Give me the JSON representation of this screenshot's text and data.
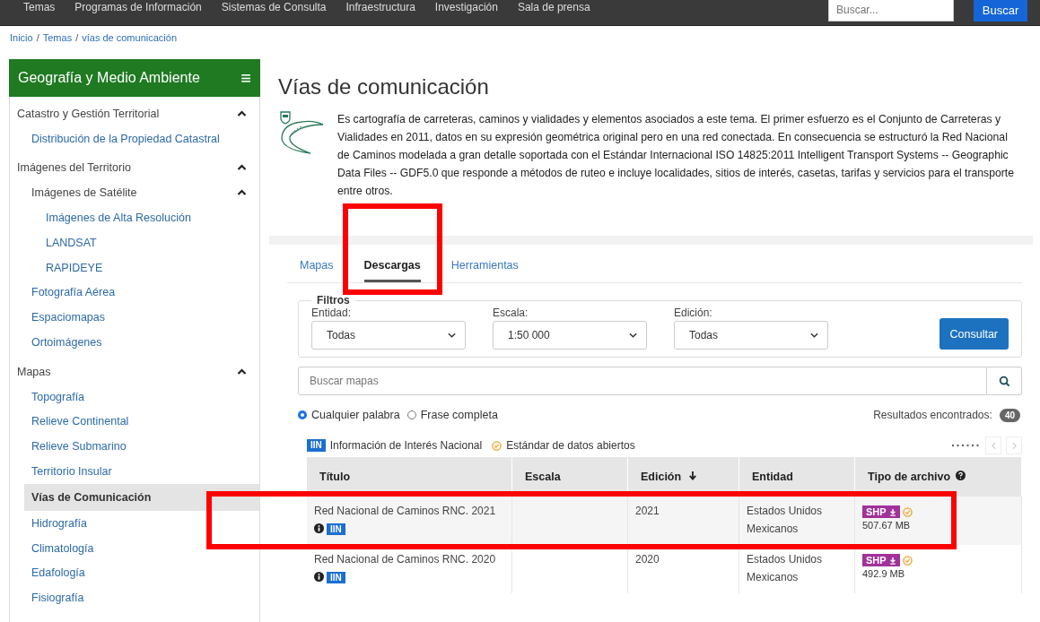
{
  "top_nav": {
    "items": [
      "Temas",
      "Programas de Información",
      "Sistemas de Consulta",
      "Infraestructura",
      "Investigación",
      "Sala de prensa"
    ],
    "search": {
      "placeholder": "Buscar..."
    },
    "search_button": "Buscar"
  },
  "breadcrumb": {
    "separator": "/",
    "items": [
      "Inicio",
      "Temas",
      "vías de comunicación"
    ]
  },
  "sidebar": {
    "title": "Geografía y Medio Ambiente",
    "menu_icon": "≡",
    "items": [
      {
        "label": "Catastro y Gestión Territorial",
        "expanded": true,
        "selected": false,
        "children": [
          {
            "label": "Distribución de la Propiedad Catastral",
            "selected": false
          }
        ]
      },
      {
        "label": "Imágenes del Territorio",
        "expanded": true,
        "selected": false,
        "children": [
          {
            "label": "Imágenes de Satélite",
            "expanded": true,
            "selected": false,
            "children": [
              {
                "label": "Imágenes de Alta Resolución",
                "selected": false
              },
              {
                "label": "LANDSAT",
                "selected": false
              },
              {
                "label": "RAPIDEYE",
                "selected": false
              }
            ]
          },
          {
            "label": "Fotografía Aérea",
            "selected": false
          },
          {
            "label": "Espaciomapas",
            "selected": false
          },
          {
            "label": "Ortoimágenes",
            "selected": false
          }
        ]
      },
      {
        "label": "Mapas",
        "expanded": true,
        "selected": false,
        "children": [
          {
            "label": "Topografía",
            "selected": false
          },
          {
            "label": "Relieve Continental",
            "selected": false
          },
          {
            "label": "Relieve Submarino",
            "selected": false
          },
          {
            "label": "Territorio Insular",
            "selected": false
          },
          {
            "label": "Vías de Comunicación",
            "selected": true
          },
          {
            "label": "Hidrografía",
            "selected": false
          },
          {
            "label": "Climatología",
            "selected": false
          },
          {
            "label": "Edafología",
            "selected": false
          },
          {
            "label": "Fisiografía",
            "selected": false
          }
        ]
      }
    ]
  },
  "page_title": "Vías de comunicación",
  "intro": "Es cartografía de carreteras, caminos y vialidades y elementos asociados a este tema. El primer esfuerzo es el Conjunto de Carreteras y Vialidades en 2011, datos en su expresión geométrica original pero en una red conectada. En consecuencia se estructuró la Red Nacional de Caminos modelada a gran detalle soportada con el Estándar Internacional ISO 14825:2011 Intelligent Transport Systems -- Geographic Data Files -- GDF5.0 que responde a métodos de ruteo e incluye localidades, sitios de interés, casetas, tarifas y servicios para el transporte entre otros.",
  "tabs": [
    {
      "label": "Mapas",
      "selected": false,
      "highlighted": false
    },
    {
      "label": "Descargas",
      "selected": true,
      "highlighted": true
    },
    {
      "label": "Herramientas",
      "selected": false,
      "highlighted": false
    }
  ],
  "filters": {
    "legend": "Filtros",
    "fields": [
      {
        "label": "Entidad:",
        "value": "Todas"
      },
      {
        "label": "Escala:",
        "value": "1:50 000"
      },
      {
        "label": "Edición:",
        "value": "Todas"
      }
    ],
    "button": "Consultar"
  },
  "map_search": {
    "placeholder": "Buscar mapas"
  },
  "match_options": [
    {
      "label": "Cualquier palabra",
      "selected": true
    },
    {
      "label": "Frase completa",
      "selected": false
    }
  ],
  "results": {
    "label": "Resultados encontrados:",
    "count": "40"
  },
  "legend": {
    "iin_badge": "IIN",
    "iin_label": "Información de Interés Nacional",
    "open_label": "Estándar de datos abiertos"
  },
  "table": {
    "columns": [
      {
        "label": "Título",
        "sorted": false,
        "help": false
      },
      {
        "label": "Escala",
        "sorted": false,
        "help": false
      },
      {
        "label": "Edición",
        "sorted": true,
        "help": false
      },
      {
        "label": "Entidad",
        "sorted": false,
        "help": false
      },
      {
        "label": "Tipo de archivo",
        "sorted": false,
        "help": true
      }
    ],
    "rows": [
      {
        "title": "Red Nacional de Caminos RNC. 2021",
        "highlighted": true,
        "badge": "IIN",
        "edition": "2021",
        "entity": "Estados Unidos Mexicanos",
        "format": "SHP",
        "size": "507.67 MB"
      },
      {
        "title": "Red Nacional de Caminos RNC. 2020",
        "highlighted": false,
        "badge": "IIN",
        "edition": "2020",
        "entity": "Estados Unidos Mexicanos",
        "format": "SHP",
        "size": "492.9 MB"
      }
    ]
  }
}
